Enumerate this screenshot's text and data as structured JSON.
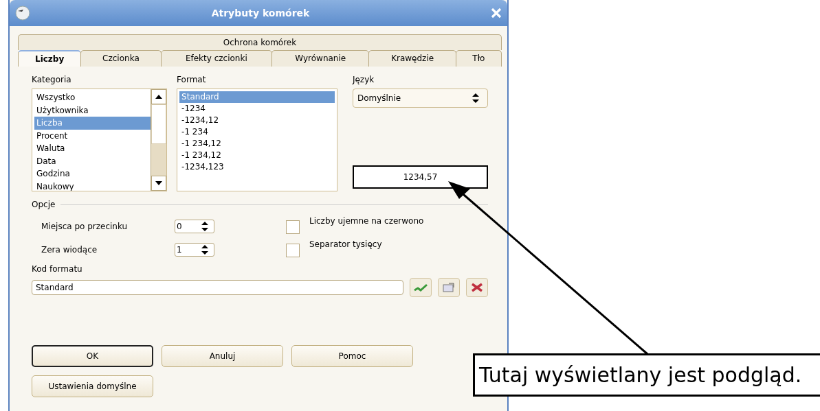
{
  "window": {
    "title": "Atrybuty komórek"
  },
  "tabs_top": [
    {
      "label": "Ochrona komórek",
      "selected": false
    }
  ],
  "tabs": [
    {
      "label": "Liczby",
      "selected": true
    },
    {
      "label": "Czcionka",
      "selected": false
    },
    {
      "label": "Efekty czcionki",
      "selected": false
    },
    {
      "label": "Wyrównanie",
      "selected": false
    },
    {
      "label": "Krawędzie",
      "selected": false
    },
    {
      "label": "Tło",
      "selected": false
    }
  ],
  "category": {
    "label": "Kategoria",
    "items": [
      {
        "label": "Wszystko",
        "selected": false
      },
      {
        "label": "Użytkownika",
        "selected": false
      },
      {
        "label": "Liczba",
        "selected": true
      },
      {
        "label": "Procent",
        "selected": false
      },
      {
        "label": "Waluta",
        "selected": false
      },
      {
        "label": "Data",
        "selected": false
      },
      {
        "label": "Godzina",
        "selected": false
      },
      {
        "label": "Naukowy",
        "selected": false
      }
    ]
  },
  "format": {
    "label": "Format",
    "items": [
      {
        "label": "Standard",
        "selected": true
      },
      {
        "label": "-1234",
        "selected": false
      },
      {
        "label": "-1234,12",
        "selected": false
      },
      {
        "label": "-1 234",
        "selected": false
      },
      {
        "label": "-1 234,12",
        "selected": false
      },
      {
        "label": "-1 234,12",
        "selected": false
      },
      {
        "label": "-1234,123",
        "selected": false
      }
    ]
  },
  "language": {
    "label": "Język",
    "value": "Domyślnie"
  },
  "preview": "1234,57",
  "options": {
    "title": "Opcje",
    "spins": [
      {
        "label": "Miejsca po przecinku",
        "value": "0"
      },
      {
        "label": "Zera wiodące",
        "value": "1"
      }
    ],
    "checks": [
      {
        "label": "Liczby ujemne na czerwono",
        "checked": false
      },
      {
        "label": "Separator tysięcy",
        "checked": false
      }
    ]
  },
  "format_code": {
    "label": "Kod formatu",
    "value": "Standard"
  },
  "buttons": [
    {
      "label": "OK",
      "default": true
    },
    {
      "label": "Anuluj",
      "default": false
    },
    {
      "label": "Pomoc",
      "default": false
    }
  ],
  "reset_button": "Ustawienia domyślne",
  "callout": "Tutaj wyświetlany jest podgląd."
}
